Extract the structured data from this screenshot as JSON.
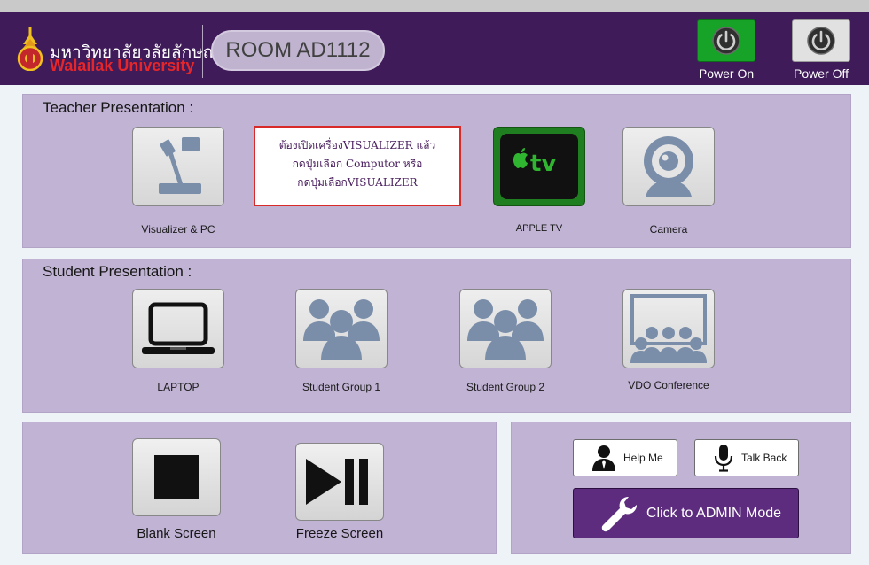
{
  "header": {
    "university_thai": "มหาวิทยาลัยวลัยลักษณ์",
    "university_en": "Walailak University",
    "room": "ROOM AD1112",
    "power_on_label": "Power On",
    "power_off_label": "Power Off"
  },
  "teacher": {
    "title": "Teacher Presentation :",
    "visualizer_label": "Visualizer & PC",
    "note_lines": [
      "ต้องเปิดเครื่องVISUALIZER  แล้ว",
      "กดปุ่มเลือก Computor หรือ",
      "กดปุ่มเลือกVISUALIZER"
    ],
    "appletv_label": "APPLE TV",
    "appletv_logo_text": "tv",
    "camera_label": "Camera"
  },
  "student": {
    "title": "Student Presentation :",
    "laptop_label": "LAPTOP",
    "group1_label": "Student Group 1",
    "group2_label": "Student Group 2",
    "vdo_label": "VDO Conference"
  },
  "controls": {
    "blank_label": "Blank Screen",
    "freeze_label": "Freeze Screen",
    "help_label": "Help Me",
    "talkback_label": "Talk Back",
    "admin_label": "Click to ADMIN Mode"
  },
  "colors": {
    "header_bg": "#3f1b5a",
    "panel_bg": "#c0b3d4",
    "power_on": "#17a228",
    "admin_bg": "#5d2c7e",
    "note_border": "#d92a2a"
  }
}
